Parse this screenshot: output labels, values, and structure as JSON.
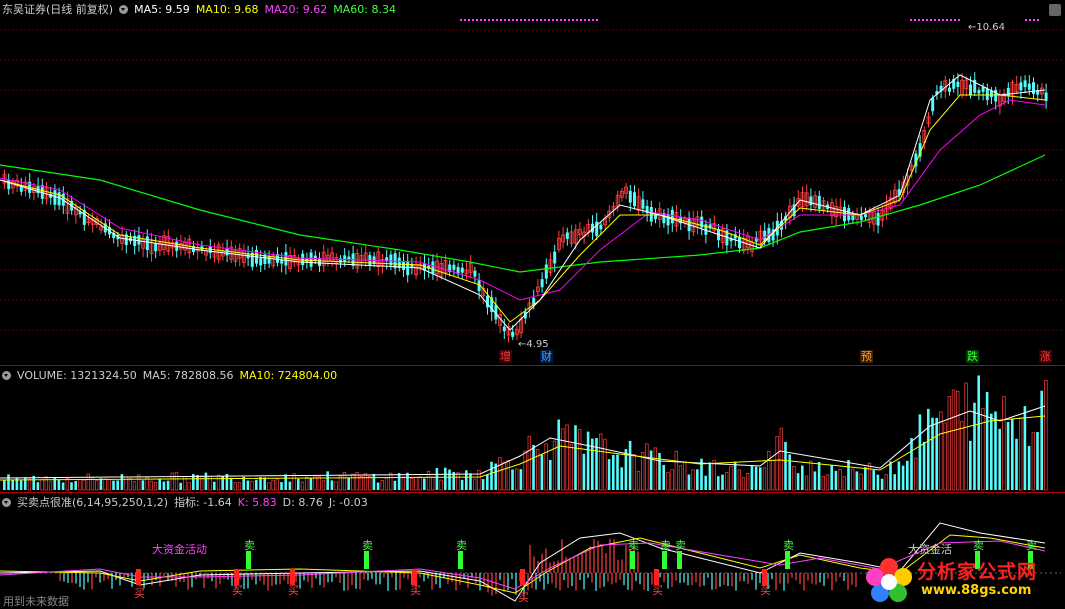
{
  "main": {
    "title": "东吴证券(日线 前复权)",
    "ma5": "MA5: 9.59",
    "ma10": "MA10: 9.68",
    "ma20": "MA20: 9.62",
    "ma60": "MA60: 8.34",
    "high_label": "10.64",
    "low_label": "4.95",
    "events": [
      "增",
      "财",
      "预",
      "跌",
      "涨"
    ]
  },
  "volume": {
    "label": "VOLUME: 1321324.50",
    "ma5": "MA5: 782808.56",
    "ma10": "MA10: 724804.00"
  },
  "indicator": {
    "name": "买卖点很准(6,14,95,250,1,2)",
    "zhibiao": "指标: -1.64",
    "k": "K: 5.83",
    "d": "D: 8.76",
    "j": "J: -0.03",
    "big_money": "大资金活动",
    "big_money2": "大资金活",
    "sell": "卖",
    "buy": "买",
    "footer": "用到未来数据"
  },
  "watermark": {
    "title": "分析家公式网",
    "url": "www.88gs.com"
  },
  "colors": {
    "up": "#ff4040",
    "down": "#54fcfc",
    "ma5": "#ffffff",
    "ma10": "#ffff00",
    "ma20": "#ff00ff",
    "ma60": "#00ff00",
    "grid": "#800000"
  }
}
